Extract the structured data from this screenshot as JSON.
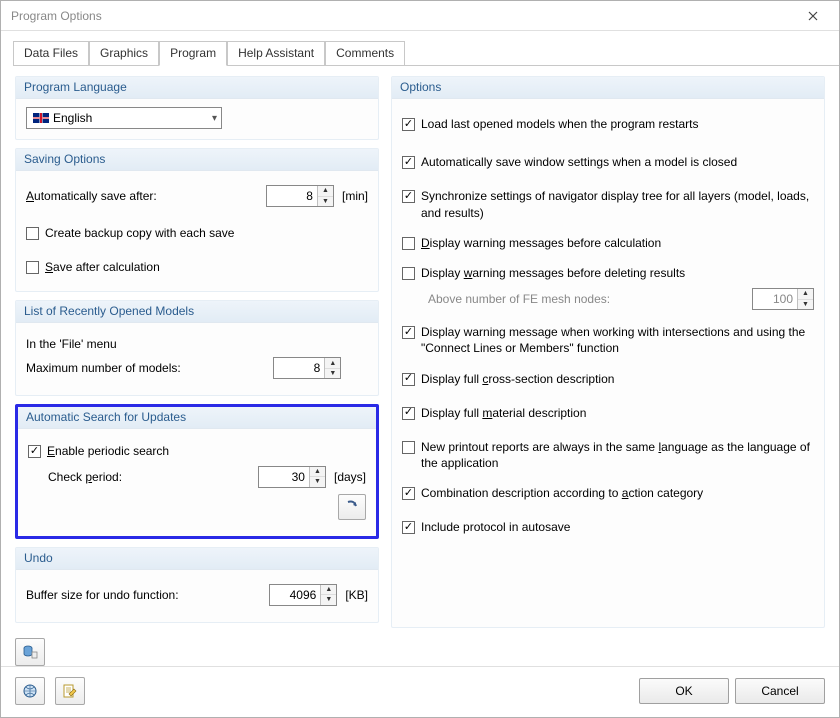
{
  "window": {
    "title": "Program Options"
  },
  "tabs": {
    "data_files": "Data Files",
    "graphics": "Graphics",
    "program": "Program",
    "help_assistant": "Help Assistant",
    "comments": "Comments"
  },
  "left": {
    "language": {
      "header": "Program Language",
      "value": "English"
    },
    "saving": {
      "header": "Saving Options",
      "auto_save_label_pre": "A",
      "auto_save_label_post": "utomatically save after:",
      "auto_save_value": "8",
      "auto_save_unit": "[min]",
      "backup_label": "Create backup copy with each save",
      "save_after_calc_pre": "S",
      "save_after_calc_post": "ave after calculation"
    },
    "recent": {
      "header": "List of Recently Opened Models",
      "in_file_menu": "In the 'File' menu",
      "max_models_label": "Maximum number of models:",
      "max_models_value": "8"
    },
    "updates": {
      "header": "Automatic Search for Updates",
      "enable_pre": "E",
      "enable_post": "nable periodic search",
      "check_period_label_pre": "Check ",
      "check_period_label_u": "p",
      "check_period_label_post": "eriod:",
      "check_period_value": "30",
      "check_period_unit": "[days]"
    },
    "undo": {
      "header": "Undo",
      "buffer_label": "Buffer size for undo function:",
      "buffer_value": "4096",
      "buffer_unit": "[KB]"
    }
  },
  "right": {
    "header": "Options",
    "load_last": "Load last opened models when the program restarts",
    "auto_save_window": "Automatically save window settings when a model is closed",
    "sync_navigator": "Synchronize settings of navigator display tree for all layers (model, loads, and results)",
    "warn_before_calc_pre": "D",
    "warn_before_calc_post": "isplay warning messages before calculation",
    "warn_before_delete_pre": "Display ",
    "warn_before_delete_u": "w",
    "warn_before_delete_post": "arning messages before deleting results",
    "above_fe_nodes_label": "Above number of FE mesh nodes:",
    "above_fe_nodes_value": "100",
    "warn_intersections": "Display warning message when working with intersections and using the \"Connect Lines or Members\" function",
    "full_cs_pre": "Display full ",
    "full_cs_u": "c",
    "full_cs_post": "ross-section description",
    "full_mat_pre": "Display full ",
    "full_mat_u": "m",
    "full_mat_post": "aterial description",
    "printout_lang_pre": "New printout reports are always in the same ",
    "printout_lang_u": "l",
    "printout_lang_post": "anguage as the language of the application",
    "combo_desc_pre": "Combination description according to ",
    "combo_desc_u": "a",
    "combo_desc_post": "ction category",
    "include_protocol": "Include protocol in autosave"
  },
  "footer": {
    "ok": "OK",
    "cancel": "Cancel"
  }
}
